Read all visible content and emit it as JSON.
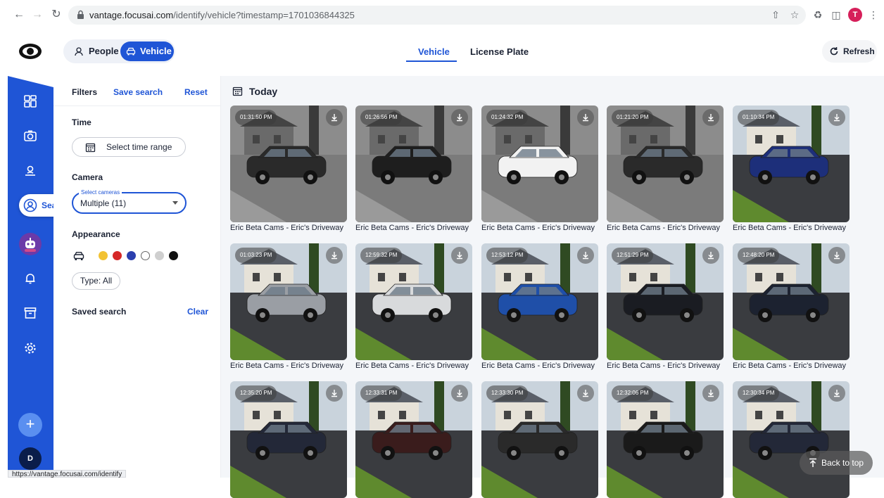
{
  "browser": {
    "url_host": "vantage.focusai.com",
    "url_path": "/identify/vehicle?timestamp=1701036844325",
    "profile_initial": "T",
    "status_url": "https://vantage.focusai.com/identify"
  },
  "header": {
    "mode_people": "People",
    "mode_vehicle": "Vehicle",
    "tabs": [
      {
        "label": "Vehicle"
      },
      {
        "label": "License Plate"
      }
    ],
    "refresh": "Refresh"
  },
  "sidebar": {
    "search_label": "Search",
    "user_initial": "D"
  },
  "filters": {
    "title": "Filters",
    "save_search": "Save search",
    "reset": "Reset",
    "time_title": "Time",
    "time_button": "Select time range",
    "camera_title": "Camera",
    "camera_legend": "Select cameras",
    "camera_value": "Multiple (11)",
    "appearance_title": "Appearance",
    "colors": [
      "#f2c233",
      "#d62828",
      "#2b3fae",
      "#ffffff",
      "#cfcfcf",
      "#111111"
    ],
    "type_chip": "Type: All",
    "saved_search_title": "Saved search",
    "clear": "Clear"
  },
  "main": {
    "date_label": "Today",
    "cards": [
      {
        "time": "01:31:50 PM",
        "caption": "Eric Beta Cams - Eric's Driveway",
        "tone": "gray",
        "car": "#2a2a2a"
      },
      {
        "time": "01:26:56 PM",
        "caption": "Eric Beta Cams - Eric's Driveway",
        "tone": "gray",
        "car": "#1e1e1e"
      },
      {
        "time": "01:24:32 PM",
        "caption": "Eric Beta Cams - Eric's Driveway",
        "tone": "gray",
        "car": "#f2f2f2"
      },
      {
        "time": "01:21:20 PM",
        "caption": "Eric Beta Cams - Eric's Driveway",
        "tone": "gray",
        "car": "#2a2a2a"
      },
      {
        "time": "01:10:34 PM",
        "caption": "Eric Beta Cams - Eric's Driveway",
        "tone": "color",
        "car": "#1d2f7a"
      },
      {
        "time": "01:03:23 PM",
        "caption": "Eric Beta Cams - Eric's Driveway",
        "tone": "color",
        "car": "#9a9ea4"
      },
      {
        "time": "12:59:32 PM",
        "caption": "Eric Beta Cams - Eric's Driveway",
        "tone": "color",
        "car": "#d8dadc"
      },
      {
        "time": "12:53:12 PM",
        "caption": "Eric Beta Cams - Eric's Driveway",
        "tone": "color",
        "car": "#1f4fa8"
      },
      {
        "time": "12:51:29 PM",
        "caption": "Eric Beta Cams - Eric's Driveway",
        "tone": "color",
        "car": "#1a1c22"
      },
      {
        "time": "12:48:20 PM",
        "caption": "Eric Beta Cams - Eric's Driveway",
        "tone": "color",
        "car": "#1c2230"
      },
      {
        "time": "12:35:20 PM",
        "caption": "",
        "tone": "color",
        "car": "#232838"
      },
      {
        "time": "12:33:31 PM",
        "caption": "",
        "tone": "color",
        "car": "#3a1c1c"
      },
      {
        "time": "12:33:30 PM",
        "caption": "",
        "tone": "color",
        "car": "#2a2a2a"
      },
      {
        "time": "12:32:06 PM",
        "caption": "",
        "tone": "color",
        "car": "#1a1a1a"
      },
      {
        "time": "12:30:34 PM",
        "caption": "",
        "tone": "color",
        "car": "#232838"
      }
    ],
    "back_to_top": "Back to top"
  }
}
